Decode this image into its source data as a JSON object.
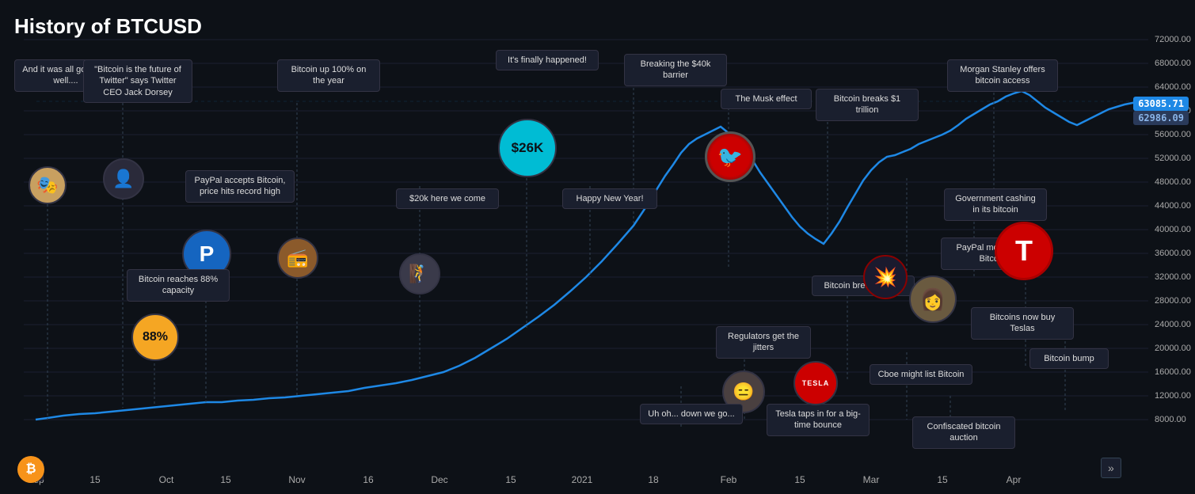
{
  "title": "History of BTCUSD",
  "yLabels": [
    {
      "value": "72000.00",
      "pct": 3
    },
    {
      "value": "68000.00",
      "pct": 8
    },
    {
      "value": "64000.00",
      "pct": 14
    },
    {
      "value": "60000.00",
      "pct": 19
    },
    {
      "value": "56000.00",
      "pct": 25
    },
    {
      "value": "52000.00",
      "pct": 30
    },
    {
      "value": "48000.00",
      "pct": 36
    },
    {
      "value": "44000.00",
      "pct": 41
    },
    {
      "value": "40000.00",
      "pct": 47
    },
    {
      "value": "36000.00",
      "pct": 52
    },
    {
      "value": "32000.00",
      "pct": 58
    },
    {
      "value": "28000.00",
      "pct": 63
    },
    {
      "value": "24000.00",
      "pct": 69
    },
    {
      "value": "20000.00",
      "pct": 74
    },
    {
      "value": "16000.00",
      "pct": 80
    },
    {
      "value": "12000.00",
      "pct": 85
    },
    {
      "value": "8000.00",
      "pct": 91
    }
  ],
  "xLabels": [
    {
      "label": "Sep",
      "pct": 3
    },
    {
      "label": "15",
      "pct": 8
    },
    {
      "label": "Oct",
      "pct": 14
    },
    {
      "label": "15",
      "pct": 19
    },
    {
      "label": "Nov",
      "pct": 25
    },
    {
      "label": "16",
      "pct": 31
    },
    {
      "label": "Dec",
      "pct": 37
    },
    {
      "label": "15",
      "pct": 43
    },
    {
      "label": "2021",
      "pct": 49
    },
    {
      "label": "18",
      "pct": 55
    },
    {
      "label": "Feb",
      "pct": 61
    },
    {
      "label": "15",
      "pct": 67
    },
    {
      "label": "Mar",
      "pct": 73
    },
    {
      "label": "15",
      "pct": 79
    },
    {
      "label": "Apr",
      "pct": 85
    }
  ],
  "annotations": [
    {
      "id": "ann1",
      "text": "And it was all going so well....",
      "x_pct": 3,
      "y_top_pct": 14,
      "line_y_pct": 88,
      "circle_color": "#c8a060",
      "circle_text": "🎭",
      "circle_y_pct": 74,
      "circle_size": 48
    },
    {
      "id": "ann2",
      "text": "\"Bitcoin is the future of Twitter\" says Twitter CEO Jack Dorsey",
      "x_pct": 10,
      "y_top_pct": 14,
      "line_y_pct": 88,
      "circle_color": "#333",
      "circle_text": "👤",
      "circle_y_pct": 72,
      "circle_size": 52
    },
    {
      "id": "ann3",
      "text": "PayPal accepts Bitcoin, price hits record high",
      "x_pct": 18,
      "y_top_pct": 36,
      "line_y_pct": 88,
      "circle_color": "#1565c0",
      "circle_text": "P",
      "circle_y_pct": 56,
      "circle_size": 60
    },
    {
      "id": "ann4",
      "text": "Bitcoin reaches 88% capacity",
      "x_pct": 13,
      "y_top_pct": 56,
      "line_y_pct": 86,
      "circle_color": "#f5a623",
      "circle_text": "88%",
      "circle_y_pct": 65,
      "circle_size": 58
    },
    {
      "id": "ann5",
      "text": "Bitcoin up 100% on the year",
      "x_pct": 25,
      "y_top_pct": 14,
      "line_y_pct": 80,
      "circle_color": "#8B4513",
      "circle_text": "📻",
      "circle_y_pct": 50,
      "circle_size": 52
    },
    {
      "id": "ann6",
      "text": "$20k here we come",
      "x_pct": 36,
      "y_top_pct": 38,
      "line_y_pct": 78,
      "circle_color": "#444",
      "circle_text": "🧗",
      "circle_y_pct": 52,
      "circle_size": 52
    },
    {
      "id": "ann7",
      "text": "It's finally happened!",
      "x_pct": 44,
      "y_top_pct": 10,
      "line_y_pct": 55,
      "circle_color": "#00bcd4",
      "circle_text": "$26K",
      "circle_y_pct": 26,
      "circle_size": 72
    },
    {
      "id": "ann8",
      "text": "Breaking the $40k barrier",
      "x_pct": 52,
      "y_top_pct": 12,
      "line_y_pct": 75,
      "circle_color": null,
      "circle_text": "",
      "circle_y_pct": 55,
      "circle_size": 0
    },
    {
      "id": "ann9",
      "text": "Happy New Year!",
      "x_pct": 50,
      "y_top_pct": 38,
      "line_y_pct": 82,
      "circle_color": null,
      "circle_text": "",
      "circle_y_pct": 60,
      "circle_size": 0
    },
    {
      "id": "ann10",
      "text": "The Musk effect",
      "x_pct": 61,
      "y_top_pct": 18,
      "line_y_pct": 55,
      "circle_color": "#222",
      "circle_text": "🐦",
      "circle_y_pct": 26,
      "circle_size": 62
    },
    {
      "id": "ann11",
      "text": "Regulators get the jitters",
      "x_pct": 61,
      "y_top_pct": 66,
      "line_y_pct": 85,
      "circle_color": "#4a4a4a",
      "circle_text": "😑",
      "circle_y_pct": 75,
      "circle_size": 52
    },
    {
      "id": "ann12",
      "text": "Uh oh... down we go...",
      "x_pct": 57,
      "y_top_pct": 78,
      "line_y_pct": 90,
      "circle_color": null,
      "circle_text": "",
      "circle_y_pct": 75,
      "circle_size": 0
    },
    {
      "id": "ann13",
      "text": "Bitcoin breaks $1 trillion",
      "x_pct": 70,
      "y_top_pct": 18,
      "line_y_pct": 58,
      "circle_color": null,
      "circle_text": "",
      "circle_y_pct": 35,
      "circle_size": 0
    },
    {
      "id": "ann14",
      "text": "Tesla taps in for a big-time bounce",
      "x_pct": 65,
      "y_top_pct": 78,
      "line_y_pct": 90,
      "circle_color": "#cc0000",
      "circle_text": "TESLA",
      "circle_y_pct": 73,
      "circle_size": 58
    },
    {
      "id": "ann15",
      "text": "Bitcoin breaks $50k!",
      "x_pct": 70,
      "y_top_pct": 56,
      "line_y_pct": 78,
      "circle_color": null,
      "circle_text": "",
      "circle_y_pct": 65,
      "circle_size": 0
    },
    {
      "id": "ann16",
      "text": "PayPal moves into Bitcoin",
      "x_pct": 76,
      "y_top_pct": 44,
      "line_y_pct": 60,
      "circle_color": "#8B0000",
      "circle_text": "💥",
      "circle_y_pct": 36,
      "circle_size": 52
    },
    {
      "id": "ann17",
      "text": "Cboe might list Bitcoin",
      "x_pct": 76,
      "y_top_pct": 71,
      "line_y_pct": 85,
      "circle_color": null,
      "circle_text": "",
      "circle_y_pct": 75,
      "circle_size": 0
    },
    {
      "id": "ann18",
      "text": "Morgan Stanley offers bitcoin access",
      "x_pct": 83,
      "y_top_pct": 12,
      "line_y_pct": 40,
      "circle_color": null,
      "circle_text": "",
      "circle_y_pct": 25,
      "circle_size": 0
    },
    {
      "id": "ann19",
      "text": "Government cashing in its bitcoin",
      "x_pct": 83,
      "y_top_pct": 38,
      "line_y_pct": 60,
      "circle_color": "#b8860b",
      "circle_text": "👩",
      "circle_y_pct": 56,
      "circle_size": 58
    },
    {
      "id": "ann20",
      "text": "Bitcoins now buy Teslas",
      "x_pct": 87,
      "y_top_pct": 60,
      "line_y_pct": 75,
      "circle_color": "#cc0000",
      "circle_text": "T",
      "circle_y_pct": 46,
      "circle_size": 72
    },
    {
      "id": "ann21",
      "text": "Bitcoin bump",
      "x_pct": 89,
      "y_top_pct": 68,
      "line_y_pct": 83,
      "circle_color": null,
      "circle_text": "",
      "circle_y_pct": 70,
      "circle_size": 0
    },
    {
      "id": "ann22",
      "text": "Confiscated bitcoin auction",
      "x_pct": 78,
      "y_top_pct": 80,
      "line_y_pct": 92,
      "circle_color": null,
      "circle_text": "",
      "circle_y_pct": 80,
      "circle_size": 0
    }
  ],
  "prices": {
    "current": "63085.71",
    "prev": "62986.09"
  },
  "nav_arrow": "»",
  "colors": {
    "background": "#0d1117",
    "line": "#1e88e5",
    "annotation_bg": "#1a1f2e",
    "annotation_border": "#334455"
  }
}
